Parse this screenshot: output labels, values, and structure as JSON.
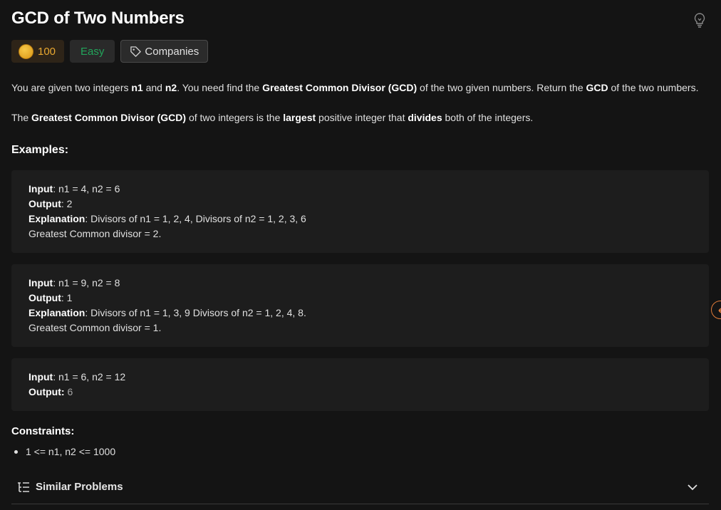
{
  "problem": {
    "title": "GCD of Two Numbers",
    "coins": "100",
    "difficulty": "Easy",
    "companies_label": "Companies"
  },
  "description": {
    "p1": [
      {
        "t": "You are given two integers ",
        "b": false
      },
      {
        "t": "n1",
        "b": true
      },
      {
        "t": " and ",
        "b": false
      },
      {
        "t": "n2",
        "b": true
      },
      {
        "t": ". You need find the ",
        "b": false
      },
      {
        "t": "Greatest Common Divisor (GCD)",
        "b": true
      },
      {
        "t": " of the two given numbers. Return the ",
        "b": false
      },
      {
        "t": "GCD",
        "b": true
      },
      {
        "t": " of the two numbers.",
        "b": false
      }
    ],
    "p2": [
      {
        "t": "The ",
        "b": false
      },
      {
        "t": "Greatest Common Divisor (GCD)",
        "b": true
      },
      {
        "t": " of two integers is the ",
        "b": false
      },
      {
        "t": "largest",
        "b": true
      },
      {
        "t": " positive integer that ",
        "b": false
      },
      {
        "t": "divides",
        "b": true
      },
      {
        "t": " both of the integers.",
        "b": false
      }
    ]
  },
  "examples_title": "Examples:",
  "labels": {
    "input": "Input",
    "output": "Output",
    "explanation": "Explanation"
  },
  "examples": [
    {
      "input": ": n1 = 4, n2 = 6",
      "output": ": 2",
      "explanation": ": Divisors of n1 = 1, 2, 4, Divisors of n2 = 1, 2, 3, 6",
      "note": "Greatest Common divisor = 2."
    },
    {
      "input": ": n1 = 9, n2 = 8",
      "output": ": 1",
      "explanation": ": Divisors of n1 = 1, 3, 9 Divisors of n2 = 1, 2, 4, 8.",
      "note": "Greatest Common divisor = 1."
    },
    {
      "input": ": n1 = 6, n2 = 12",
      "output_colon": ": ",
      "output_value": "6"
    }
  ],
  "constraints_title": "Constraints:",
  "constraints": [
    "1 <= n1, n2 <= 1000"
  ],
  "similar_problems_label": "Similar Problems",
  "icons": {
    "hint": "lightbulb-icon",
    "coin": "coin-icon",
    "tag": "tag-icon",
    "list": "list-icon",
    "expand": "chevron-down-icon",
    "side": "arrow-left-icon"
  },
  "colors": {
    "background": "#141414",
    "easy": "#22a55b",
    "coin": "#e9a830",
    "accent": "#e07b39"
  }
}
